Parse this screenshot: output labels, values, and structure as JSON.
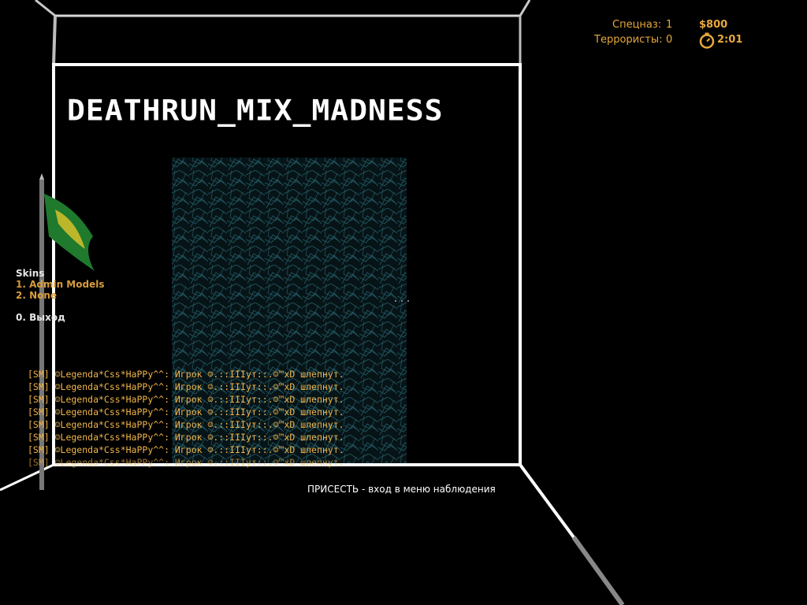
{
  "hud": {
    "ct_label": "Спецназ:",
    "ct_count": "1",
    "t_label": "Террористы:",
    "t_count": "0",
    "money": "$800",
    "timer": "2:01",
    "timer_icon": "stopwatch-icon",
    "color": "#e8a93c"
  },
  "map": {
    "title": "DEATHRUN_MIX_MADNESS"
  },
  "menu": {
    "title": "Skins",
    "items": [
      "1. Admin Models",
      "2. None"
    ],
    "exit": "0. Выход"
  },
  "chat": {
    "lines": [
      "[SM] ☺Legenda*Css*HaPPy^^: Игрок ☺.::IIIут::.☺™xD шлепнут.",
      "[SM] ☺Legenda*Css*HaPPy^^: Игрок ☺.::IIIут::.☺™xD шлепнут.",
      "[SM] ☺Legenda*Css*HaPPy^^: Игрок ☺.::IIIут::.☺™xD шлепнут.",
      "[SM] ☺Legenda*Css*HaPPy^^: Игрок ☺.::IIIут::.☺™xD шлепнут.",
      "[SM] ☺Legenda*Css*HaPPy^^: Игрок ☺.::IIIут::.☺™xD шлепнут.",
      "[SM] ☺Legenda*Css*HaPPy^^: Игрок ☺.::IIIут::.☺™xD шлепнут.",
      "[SM] ☺Legenda*Css*HaPPy^^: Игрок ☺.::IIIут::.☺™xD шлепнут.",
      "[SM] ☺Legenda*Css*HaPPy^^: Игрок ☺.::IIIут::.☺™xD шлепнут."
    ]
  },
  "hint": {
    "text": "ПРИСЕСТЬ - вход в меню наблюдения"
  },
  "colors": {
    "frame": "#ffffff",
    "flag_green": "#1f7a2e",
    "flag_yellow": "#d8c12a",
    "texture": "#123236"
  }
}
